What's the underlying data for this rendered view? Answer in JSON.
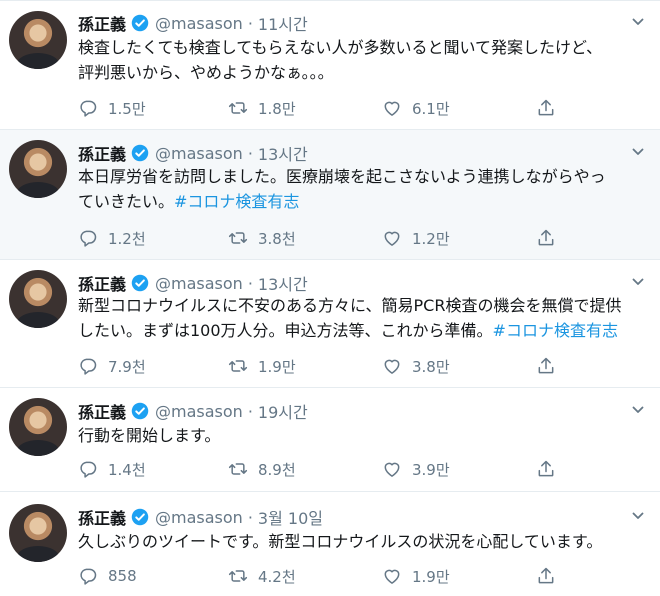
{
  "tweets": [
    {
      "name": "孫正義",
      "handle": "@masason",
      "sep": "·",
      "time": "11시간",
      "text_lines": [
        "検査したくても検査してもらえない人が多数いると聞いて発案したけど、",
        "評判悪いから、やめようかなぁ。。。"
      ],
      "hashtag": "",
      "replies": "1.5만",
      "retweets": "1.8만",
      "likes": "6.1만"
    },
    {
      "name": "孫正義",
      "handle": "@masason",
      "sep": "·",
      "time": "13시간",
      "text_lines": [
        "本日厚労省を訪問しました。医療崩壊を起こさないよう連携しながらやっ",
        "ていきたい。"
      ],
      "hashtag": "#コロナ検査有志",
      "replies": "1.2천",
      "retweets": "3.8천",
      "likes": "1.2만"
    },
    {
      "name": "孫正義",
      "handle": "@masason",
      "sep": "·",
      "time": "13시간",
      "text_lines": [
        "新型コロナウイルスに不安のある方々に、簡易PCR検査の機会を無償で提供",
        "したい。まずは100万人分。申込方法等、これから準備。"
      ],
      "hashtag": "#コロナ検査有志",
      "replies": "7.9천",
      "retweets": "1.9만",
      "likes": "3.8만"
    },
    {
      "name": "孫正義",
      "handle": "@masason",
      "sep": "·",
      "time": "19시간",
      "text_lines": [
        "行動を開始します。"
      ],
      "hashtag": "",
      "replies": "1.4천",
      "retweets": "8.9천",
      "likes": "3.9만"
    },
    {
      "name": "孫正義",
      "handle": "@masason",
      "sep": "·",
      "time": "3월 10일",
      "text_lines": [
        "久しぶりのツイートです。新型コロナウイルスの状況を心配しています。"
      ],
      "hashtag": "",
      "replies": "858",
      "retweets": "4.2천",
      "likes": "1.9만"
    }
  ],
  "colors": {
    "text": "#14171a",
    "secondary": "#657786",
    "link": "#1b95e0",
    "verified": "#1da1f2",
    "highlight_bg": "#f5f8fa",
    "divider": "#e6ecf0"
  },
  "icons": {
    "reply": "reply-icon",
    "retweet": "retweet-icon",
    "like": "like-icon",
    "share": "share-icon",
    "verified": "verified-badge-icon",
    "more": "chevron-down-icon"
  }
}
